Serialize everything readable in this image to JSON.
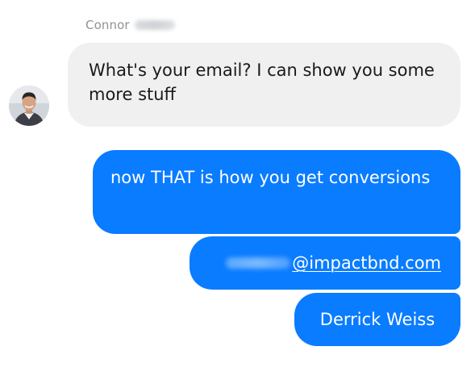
{
  "thread": {
    "sender_name": "Connor",
    "incoming": {
      "text": "What's your email? I can show you some more stuff"
    },
    "outgoing": [
      {
        "text": "now THAT is how you get conversions"
      },
      {
        "email_domain": "@impactbnd.com"
      },
      {
        "text": "Derrick Weiss"
      }
    ]
  },
  "colors": {
    "incoming_bubble": "#f1f0f0",
    "outgoing_bubble": "#0a7cff",
    "name_text": "#8f9296"
  },
  "icons": {
    "avatar": "contact-avatar"
  }
}
